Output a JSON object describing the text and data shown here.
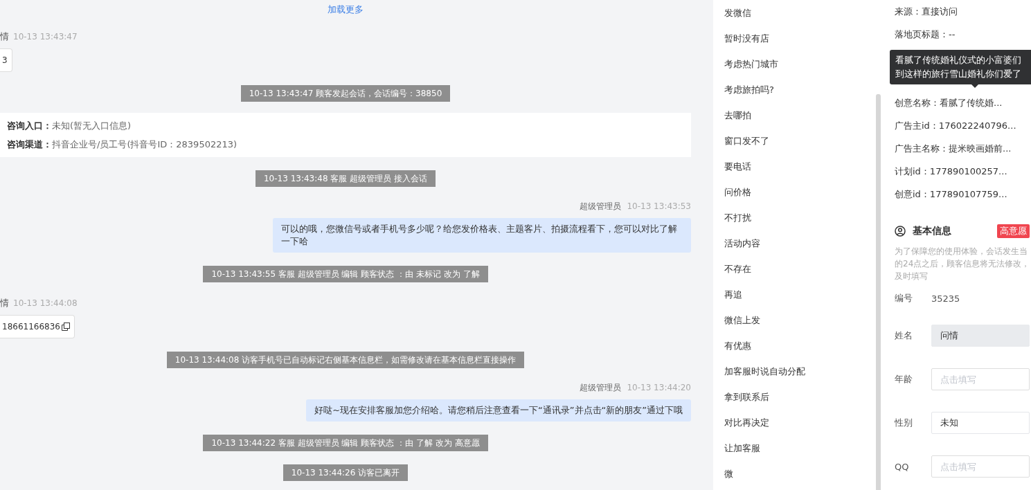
{
  "chat": {
    "load_more": "加载更多",
    "messages": [
      {
        "kind": "visitor_name",
        "name": "情",
        "time": "10-13 13:43:47"
      },
      {
        "kind": "visitor_bubble",
        "text": "3",
        "copyable": false
      },
      {
        "kind": "system",
        "text": "10-13 13:43:47 顾客发起会话，会话编号：38850"
      },
      {
        "kind": "info_card",
        "lines": [
          {
            "label": "咨询入口：",
            "value": "未知(暂无入口信息)"
          },
          {
            "label": "咨询渠道：",
            "value": "抖音企业号/员工号(抖音号ID：2839502213)"
          }
        ]
      },
      {
        "kind": "system",
        "text": "10-13 13:43:48 客服 超级管理员 接入会话"
      },
      {
        "kind": "agent_name",
        "name": "超级管理员",
        "time": "10-13 13:43:53"
      },
      {
        "kind": "agent_bubble",
        "text": "可以的哦，您微信号或者手机号多少呢？给您发价格表、主题客片、拍摄流程看下，您可以对比了解一下哈"
      },
      {
        "kind": "system",
        "text": "10-13 13:43:55 客服 超级管理员 编辑 顾客状态 ：由 未标记 改为 了解"
      },
      {
        "kind": "visitor_name",
        "name": "情",
        "time": "10-13 13:44:08"
      },
      {
        "kind": "visitor_bubble",
        "text": "18661166836",
        "copyable": true
      },
      {
        "kind": "system",
        "text": "10-13 13:44:08 访客手机号已自动标记右侧基本信息栏，如需修改请在基本信息栏直接操作"
      },
      {
        "kind": "agent_name",
        "name": "超级管理员",
        "time": "10-13 13:44:20"
      },
      {
        "kind": "agent_bubble",
        "text": "好哒~现在安排客服加您介绍哈。请您稍后注意查看一下“通讯录”并点击“新的朋友”通过下哦"
      },
      {
        "kind": "system",
        "text": "10-13 13:44:22 客服 超级管理员 编辑 顾客状态 ：由 了解 改为 高意愿"
      },
      {
        "kind": "system",
        "text": "10-13 13:44:26 访客已离开"
      }
    ]
  },
  "quick_replies": [
    "发微信",
    "暂时没有店",
    "考虑热门城市",
    "考虑旅拍吗?",
    "去哪拍",
    "窗口发不了",
    "要电话",
    "问价格",
    "不打扰",
    "活动内容",
    "不存在",
    "再追",
    "微信上发",
    "有优惠",
    "加客服时说自动分配",
    "拿到联系后",
    "对比再决定",
    "让加客服",
    "微"
  ],
  "source_info": {
    "rows_top": [
      "来源：直接访问",
      "落地页标题：--"
    ],
    "tooltip": [
      "看腻了传统婚礼仪式的小富婆们",
      "到这样的旅行雪山婚礼你们爱了"
    ],
    "rows_bottom": [
      "创意名称：看腻了传统婚...",
      "广告主id：176022240796...",
      "广告主名称：提米映画婚前...",
      "计划id：177890100257...",
      "创意id：177890107759..."
    ]
  },
  "basic_info": {
    "title": "基本信息",
    "badge": "高意愿",
    "notice": [
      "为了保障您的使用体验，会话发生当",
      "的24点之后，顾客信息将无法修改，",
      "及时填写"
    ],
    "id_label": "编号",
    "id_value": "35235",
    "fields": [
      {
        "label": "姓名",
        "value": "问情",
        "readonly": true
      },
      {
        "label": "年龄",
        "placeholder": "点击填写",
        "readonly": false
      },
      {
        "label": "性别",
        "value": "未知",
        "readonly": false
      },
      {
        "label": "QQ",
        "placeholder": "点击填写",
        "readonly": false
      }
    ]
  }
}
